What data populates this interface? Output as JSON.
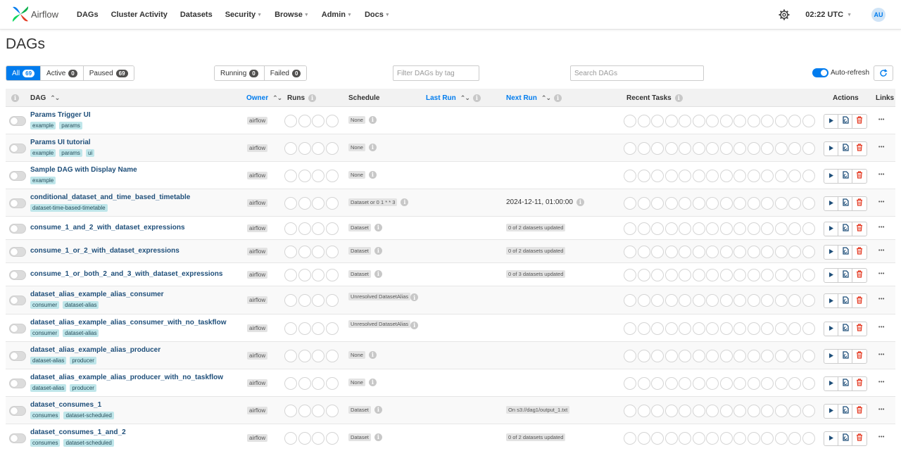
{
  "app": {
    "name": "Airflow"
  },
  "nav": {
    "items": [
      {
        "label": "DAGs",
        "caret": false
      },
      {
        "label": "Cluster Activity",
        "caret": false
      },
      {
        "label": "Datasets",
        "caret": false
      },
      {
        "label": "Security",
        "caret": true
      },
      {
        "label": "Browse",
        "caret": true
      },
      {
        "label": "Admin",
        "caret": true
      },
      {
        "label": "Docs",
        "caret": true
      }
    ],
    "time": "02:22 UTC",
    "avatar": "AU"
  },
  "page": {
    "title": "DAGs"
  },
  "filters": {
    "status_tabs": [
      {
        "label": "All",
        "count": "69",
        "active": true
      },
      {
        "label": "Active",
        "count": "0",
        "active": false
      },
      {
        "label": "Paused",
        "count": "69",
        "active": false
      }
    ],
    "run_tabs": [
      {
        "label": "Running",
        "count": "0"
      },
      {
        "label": "Failed",
        "count": "0"
      }
    ],
    "tag_placeholder": "Filter DAGs by tag",
    "search_placeholder": "Search DAGs",
    "auto_refresh_label": "Auto-refresh"
  },
  "table": {
    "headers": {
      "dag": "DAG",
      "owner": "Owner",
      "runs": "Runs",
      "schedule": "Schedule",
      "last_run": "Last Run",
      "next_run": "Next Run",
      "recent_tasks": "Recent Tasks",
      "actions": "Actions",
      "links": "Links"
    },
    "rows": [
      {
        "name": "Params Trigger UI",
        "tags": [
          "example",
          "params"
        ],
        "owner": "airflow",
        "schedule": "None",
        "next_run": "",
        "next_badge": ""
      },
      {
        "name": "Params UI tutorial",
        "tags": [
          "example",
          "params",
          "ui"
        ],
        "owner": "airflow",
        "schedule": "None",
        "next_run": "",
        "next_badge": ""
      },
      {
        "name": "Sample DAG with Display Name",
        "tags": [
          "example"
        ],
        "owner": "airflow",
        "schedule": "None",
        "next_run": "",
        "next_badge": ""
      },
      {
        "name": "conditional_dataset_and_time_based_timetable",
        "tags": [
          "dataset-time-based-timetable"
        ],
        "owner": "airflow",
        "schedule": "Dataset or 0 1 * * 3",
        "next_run": "2024-12-11, 01:00:00",
        "next_badge": ""
      },
      {
        "name": "consume_1_and_2_with_dataset_expressions",
        "tags": [],
        "owner": "airflow",
        "schedule": "Dataset",
        "next_run": "",
        "next_badge": "0 of 2 datasets updated"
      },
      {
        "name": "consume_1_or_2_with_dataset_expressions",
        "tags": [],
        "owner": "airflow",
        "schedule": "Dataset",
        "next_run": "",
        "next_badge": "0 of 2 datasets updated"
      },
      {
        "name": "consume_1_or_both_2_and_3_with_dataset_expressions",
        "tags": [],
        "owner": "airflow",
        "schedule": "Dataset",
        "next_run": "",
        "next_badge": "0 of 3 datasets updated"
      },
      {
        "name": "dataset_alias_example_alias_consumer",
        "tags": [
          "consumer",
          "dataset-alias"
        ],
        "owner": "airflow",
        "schedule": "Unresolved DatasetAlias",
        "next_run": "",
        "next_badge": ""
      },
      {
        "name": "dataset_alias_example_alias_consumer_with_no_taskflow",
        "tags": [
          "consumer",
          "dataset-alias"
        ],
        "owner": "airflow",
        "schedule": "Unresolved DatasetAlias",
        "next_run": "",
        "next_badge": ""
      },
      {
        "name": "dataset_alias_example_alias_producer",
        "tags": [
          "dataset-alias",
          "producer"
        ],
        "owner": "airflow",
        "schedule": "None",
        "next_run": "",
        "next_badge": ""
      },
      {
        "name": "dataset_alias_example_alias_producer_with_no_taskflow",
        "tags": [
          "dataset-alias",
          "producer"
        ],
        "owner": "airflow",
        "schedule": "None",
        "next_run": "",
        "next_badge": ""
      },
      {
        "name": "dataset_consumes_1",
        "tags": [
          "consumes",
          "dataset-scheduled"
        ],
        "owner": "airflow",
        "schedule": "Dataset",
        "next_run": "",
        "next_badge": "On s3://dag1/output_1.txt"
      },
      {
        "name": "dataset_consumes_1_and_2",
        "tags": [
          "consumes",
          "dataset-scheduled"
        ],
        "owner": "airflow",
        "schedule": "Dataset",
        "next_run": "",
        "next_badge": "0 of 2 datasets updated"
      }
    ]
  },
  "colors": {
    "accent": "#017cee",
    "link": "#1f4f7a",
    "tag_bg": "#bfe6ea",
    "delete": "#e43921"
  }
}
